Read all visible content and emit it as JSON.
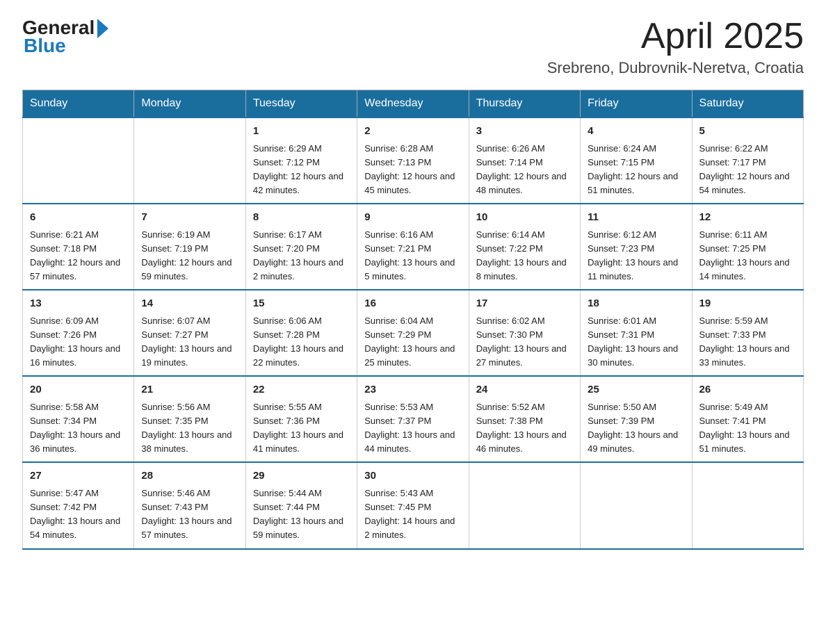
{
  "header": {
    "logo_text": "General",
    "logo_blue": "Blue",
    "title": "April 2025",
    "subtitle": "Srebreno, Dubrovnik-Neretva, Croatia"
  },
  "days_of_week": [
    "Sunday",
    "Monday",
    "Tuesday",
    "Wednesday",
    "Thursday",
    "Friday",
    "Saturday"
  ],
  "weeks": [
    [
      {
        "day": "",
        "sunrise": "",
        "sunset": "",
        "daylight": ""
      },
      {
        "day": "",
        "sunrise": "",
        "sunset": "",
        "daylight": ""
      },
      {
        "day": "1",
        "sunrise": "Sunrise: 6:29 AM",
        "sunset": "Sunset: 7:12 PM",
        "daylight": "Daylight: 12 hours and 42 minutes."
      },
      {
        "day": "2",
        "sunrise": "Sunrise: 6:28 AM",
        "sunset": "Sunset: 7:13 PM",
        "daylight": "Daylight: 12 hours and 45 minutes."
      },
      {
        "day": "3",
        "sunrise": "Sunrise: 6:26 AM",
        "sunset": "Sunset: 7:14 PM",
        "daylight": "Daylight: 12 hours and 48 minutes."
      },
      {
        "day": "4",
        "sunrise": "Sunrise: 6:24 AM",
        "sunset": "Sunset: 7:15 PM",
        "daylight": "Daylight: 12 hours and 51 minutes."
      },
      {
        "day": "5",
        "sunrise": "Sunrise: 6:22 AM",
        "sunset": "Sunset: 7:17 PM",
        "daylight": "Daylight: 12 hours and 54 minutes."
      }
    ],
    [
      {
        "day": "6",
        "sunrise": "Sunrise: 6:21 AM",
        "sunset": "Sunset: 7:18 PM",
        "daylight": "Daylight: 12 hours and 57 minutes."
      },
      {
        "day": "7",
        "sunrise": "Sunrise: 6:19 AM",
        "sunset": "Sunset: 7:19 PM",
        "daylight": "Daylight: 12 hours and 59 minutes."
      },
      {
        "day": "8",
        "sunrise": "Sunrise: 6:17 AM",
        "sunset": "Sunset: 7:20 PM",
        "daylight": "Daylight: 13 hours and 2 minutes."
      },
      {
        "day": "9",
        "sunrise": "Sunrise: 6:16 AM",
        "sunset": "Sunset: 7:21 PM",
        "daylight": "Daylight: 13 hours and 5 minutes."
      },
      {
        "day": "10",
        "sunrise": "Sunrise: 6:14 AM",
        "sunset": "Sunset: 7:22 PM",
        "daylight": "Daylight: 13 hours and 8 minutes."
      },
      {
        "day": "11",
        "sunrise": "Sunrise: 6:12 AM",
        "sunset": "Sunset: 7:23 PM",
        "daylight": "Daylight: 13 hours and 11 minutes."
      },
      {
        "day": "12",
        "sunrise": "Sunrise: 6:11 AM",
        "sunset": "Sunset: 7:25 PM",
        "daylight": "Daylight: 13 hours and 14 minutes."
      }
    ],
    [
      {
        "day": "13",
        "sunrise": "Sunrise: 6:09 AM",
        "sunset": "Sunset: 7:26 PM",
        "daylight": "Daylight: 13 hours and 16 minutes."
      },
      {
        "day": "14",
        "sunrise": "Sunrise: 6:07 AM",
        "sunset": "Sunset: 7:27 PM",
        "daylight": "Daylight: 13 hours and 19 minutes."
      },
      {
        "day": "15",
        "sunrise": "Sunrise: 6:06 AM",
        "sunset": "Sunset: 7:28 PM",
        "daylight": "Daylight: 13 hours and 22 minutes."
      },
      {
        "day": "16",
        "sunrise": "Sunrise: 6:04 AM",
        "sunset": "Sunset: 7:29 PM",
        "daylight": "Daylight: 13 hours and 25 minutes."
      },
      {
        "day": "17",
        "sunrise": "Sunrise: 6:02 AM",
        "sunset": "Sunset: 7:30 PM",
        "daylight": "Daylight: 13 hours and 27 minutes."
      },
      {
        "day": "18",
        "sunrise": "Sunrise: 6:01 AM",
        "sunset": "Sunset: 7:31 PM",
        "daylight": "Daylight: 13 hours and 30 minutes."
      },
      {
        "day": "19",
        "sunrise": "Sunrise: 5:59 AM",
        "sunset": "Sunset: 7:33 PM",
        "daylight": "Daylight: 13 hours and 33 minutes."
      }
    ],
    [
      {
        "day": "20",
        "sunrise": "Sunrise: 5:58 AM",
        "sunset": "Sunset: 7:34 PM",
        "daylight": "Daylight: 13 hours and 36 minutes."
      },
      {
        "day": "21",
        "sunrise": "Sunrise: 5:56 AM",
        "sunset": "Sunset: 7:35 PM",
        "daylight": "Daylight: 13 hours and 38 minutes."
      },
      {
        "day": "22",
        "sunrise": "Sunrise: 5:55 AM",
        "sunset": "Sunset: 7:36 PM",
        "daylight": "Daylight: 13 hours and 41 minutes."
      },
      {
        "day": "23",
        "sunrise": "Sunrise: 5:53 AM",
        "sunset": "Sunset: 7:37 PM",
        "daylight": "Daylight: 13 hours and 44 minutes."
      },
      {
        "day": "24",
        "sunrise": "Sunrise: 5:52 AM",
        "sunset": "Sunset: 7:38 PM",
        "daylight": "Daylight: 13 hours and 46 minutes."
      },
      {
        "day": "25",
        "sunrise": "Sunrise: 5:50 AM",
        "sunset": "Sunset: 7:39 PM",
        "daylight": "Daylight: 13 hours and 49 minutes."
      },
      {
        "day": "26",
        "sunrise": "Sunrise: 5:49 AM",
        "sunset": "Sunset: 7:41 PM",
        "daylight": "Daylight: 13 hours and 51 minutes."
      }
    ],
    [
      {
        "day": "27",
        "sunrise": "Sunrise: 5:47 AM",
        "sunset": "Sunset: 7:42 PM",
        "daylight": "Daylight: 13 hours and 54 minutes."
      },
      {
        "day": "28",
        "sunrise": "Sunrise: 5:46 AM",
        "sunset": "Sunset: 7:43 PM",
        "daylight": "Daylight: 13 hours and 57 minutes."
      },
      {
        "day": "29",
        "sunrise": "Sunrise: 5:44 AM",
        "sunset": "Sunset: 7:44 PM",
        "daylight": "Daylight: 13 hours and 59 minutes."
      },
      {
        "day": "30",
        "sunrise": "Sunrise: 5:43 AM",
        "sunset": "Sunset: 7:45 PM",
        "daylight": "Daylight: 14 hours and 2 minutes."
      },
      {
        "day": "",
        "sunrise": "",
        "sunset": "",
        "daylight": ""
      },
      {
        "day": "",
        "sunrise": "",
        "sunset": "",
        "daylight": ""
      },
      {
        "day": "",
        "sunrise": "",
        "sunset": "",
        "daylight": ""
      }
    ]
  ]
}
